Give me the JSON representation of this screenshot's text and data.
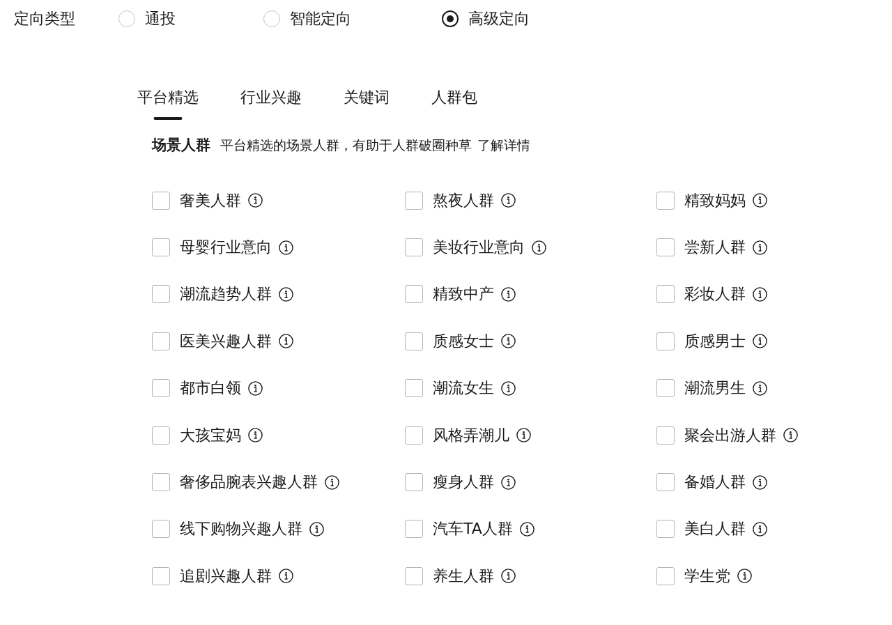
{
  "targeting": {
    "label": "定向类型",
    "options": [
      {
        "label": "通投",
        "selected": false
      },
      {
        "label": "智能定向",
        "selected": false
      },
      {
        "label": "高级定向",
        "selected": true
      }
    ]
  },
  "tabs": [
    {
      "label": "平台精选",
      "selected": true
    },
    {
      "label": "行业兴趣",
      "selected": false
    },
    {
      "label": "关键词",
      "selected": false
    },
    {
      "label": "人群包",
      "selected": false
    }
  ],
  "section": {
    "title": "场景人群",
    "description": "平台精选的场景人群，有助于人群破圈种草",
    "link": "了解详情"
  },
  "audiences": [
    {
      "label": "奢美人群",
      "checked": false
    },
    {
      "label": "熬夜人群",
      "checked": false
    },
    {
      "label": "精致妈妈",
      "checked": false
    },
    {
      "label": "母婴行业意向",
      "checked": false
    },
    {
      "label": "美妆行业意向",
      "checked": false
    },
    {
      "label": "尝新人群",
      "checked": false
    },
    {
      "label": "潮流趋势人群",
      "checked": false
    },
    {
      "label": "精致中产",
      "checked": false
    },
    {
      "label": "彩妆人群",
      "checked": false
    },
    {
      "label": "医美兴趣人群",
      "checked": false
    },
    {
      "label": "质感女士",
      "checked": false
    },
    {
      "label": "质感男士",
      "checked": false
    },
    {
      "label": "都市白领",
      "checked": false
    },
    {
      "label": "潮流女生",
      "checked": false
    },
    {
      "label": "潮流男生",
      "checked": false
    },
    {
      "label": "大孩宝妈",
      "checked": false
    },
    {
      "label": "风格弄潮儿",
      "checked": false
    },
    {
      "label": "聚会出游人群",
      "checked": false
    },
    {
      "label": "奢侈品腕表兴趣人群",
      "checked": false
    },
    {
      "label": "瘦身人群",
      "checked": false
    },
    {
      "label": "备婚人群",
      "checked": false
    },
    {
      "label": "线下购物兴趣人群",
      "checked": false
    },
    {
      "label": "汽车TA人群",
      "checked": false
    },
    {
      "label": "美白人群",
      "checked": false
    },
    {
      "label": "追剧兴趣人群",
      "checked": false
    },
    {
      "label": "养生人群",
      "checked": false
    },
    {
      "label": "学生党",
      "checked": false
    }
  ]
}
